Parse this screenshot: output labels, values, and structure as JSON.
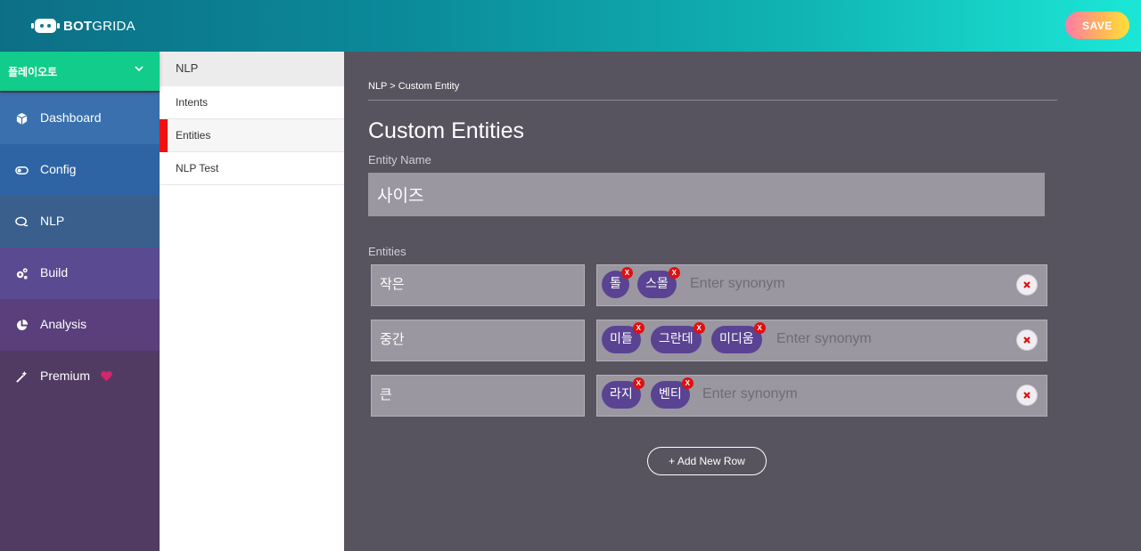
{
  "header": {
    "logo_bold": "BOT",
    "logo_rest": "GRIDA",
    "save_label": "SAVE"
  },
  "sidebar": {
    "project_name": "플레이오토",
    "items": [
      {
        "label": "Dashboard",
        "icon": "cube-icon"
      },
      {
        "label": "Config",
        "icon": "toggle-icon"
      },
      {
        "label": "NLP",
        "icon": "chat-icon"
      },
      {
        "label": "Build",
        "icon": "gears-icon"
      },
      {
        "label": "Analysis",
        "icon": "pie-chart-icon"
      },
      {
        "label": "Premium",
        "icon": "magic-wand-icon"
      }
    ],
    "premium_badge_icon": "heart-icon",
    "heart_color": "#d6246e"
  },
  "subnav": {
    "title": "NLP",
    "items": [
      "Intents",
      "Entities",
      "NLP Test"
    ],
    "active": "Entities"
  },
  "main": {
    "breadcrumb": "NLP > Custom Entity",
    "title": "Custom Entities",
    "entity_name_label": "Entity Name",
    "entity_name_value": "사이즈",
    "entities_label": "Entities",
    "synonym_placeholder": "Enter synonym",
    "rows": [
      {
        "key": "작은",
        "synonyms": [
          "톨",
          "스몰"
        ]
      },
      {
        "key": "중간",
        "synonyms": [
          "미들",
          "그란데",
          "미디움"
        ]
      },
      {
        "key": "큰",
        "synonyms": [
          "라지",
          "벤티"
        ]
      }
    ],
    "chip_remove_label": "X",
    "add_row_label": "+ Add New Row"
  }
}
